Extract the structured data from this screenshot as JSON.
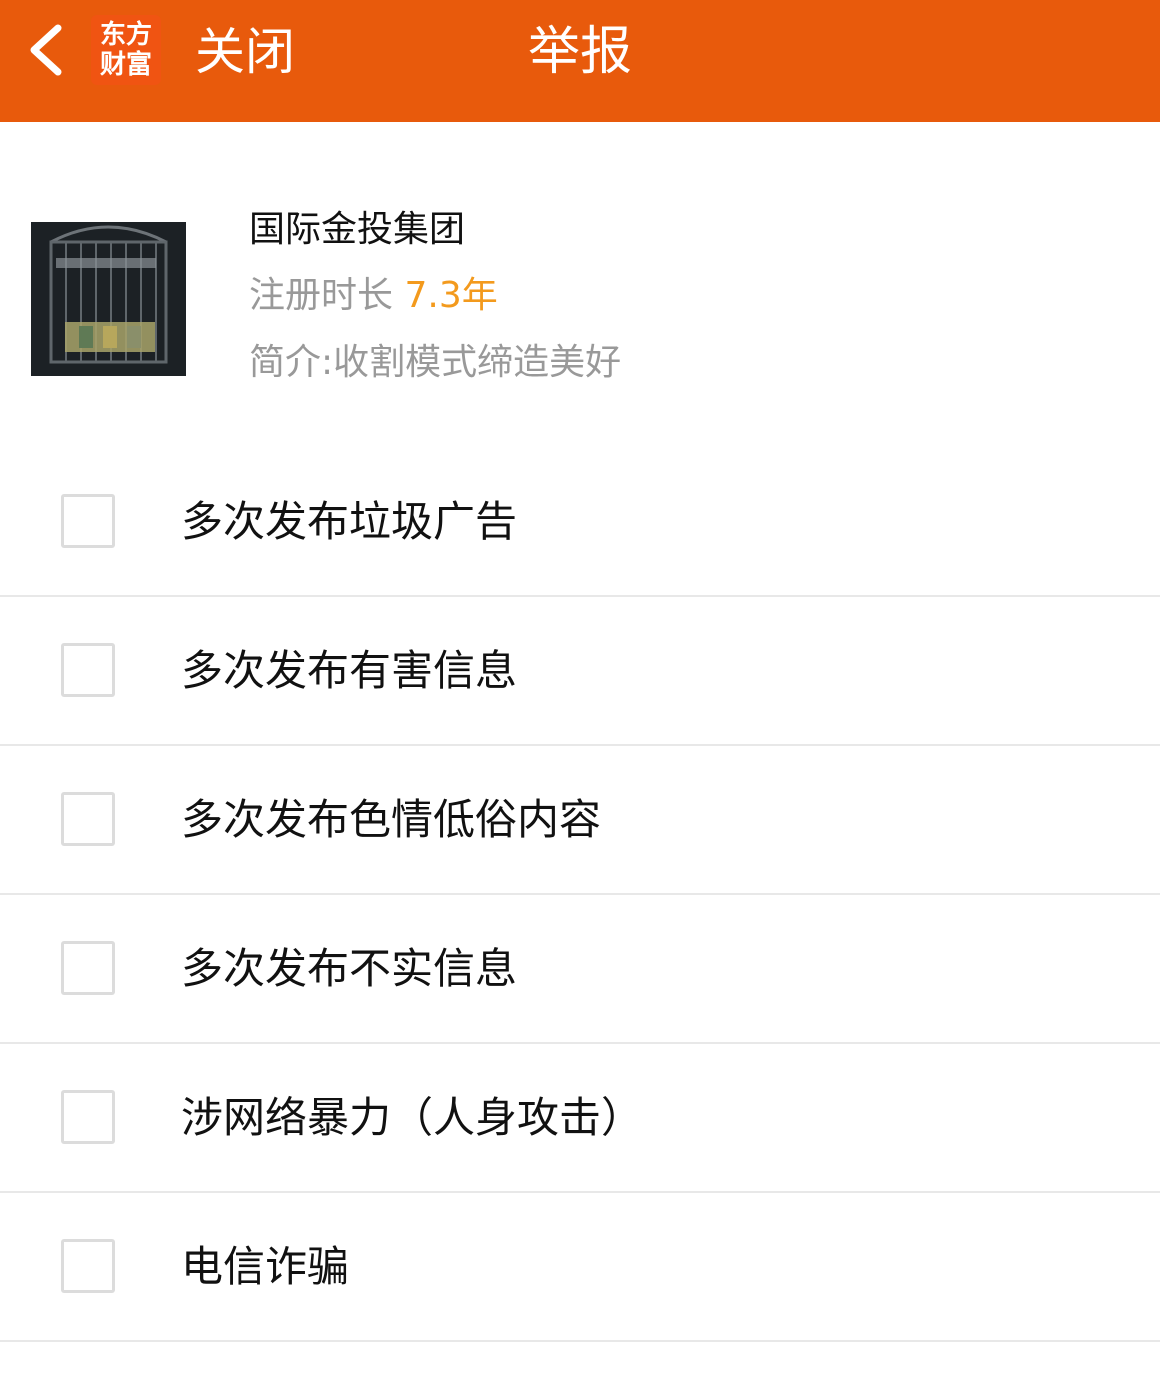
{
  "header": {
    "back_icon": "chevron-left-icon",
    "logo_text_line1": "东方",
    "logo_text_line2": "财富",
    "close_label": "关闭",
    "title": "举报",
    "background_color": "#e85a0c"
  },
  "profile": {
    "name": "国际金投集团",
    "registration_label": "注册时长",
    "registration_value": "7.3年",
    "intro_label": "简介:",
    "intro_text": "收割模式缔造美好"
  },
  "options": [
    {
      "label": "多次发布垃圾广告",
      "checked": false
    },
    {
      "label": "多次发布有害信息",
      "checked": false
    },
    {
      "label": "多次发布色情低俗内容",
      "checked": false
    },
    {
      "label": "多次发布不实信息",
      "checked": false
    },
    {
      "label": "涉网络暴力（人身攻击）",
      "checked": false
    },
    {
      "label": "电信诈骗",
      "checked": false
    }
  ]
}
